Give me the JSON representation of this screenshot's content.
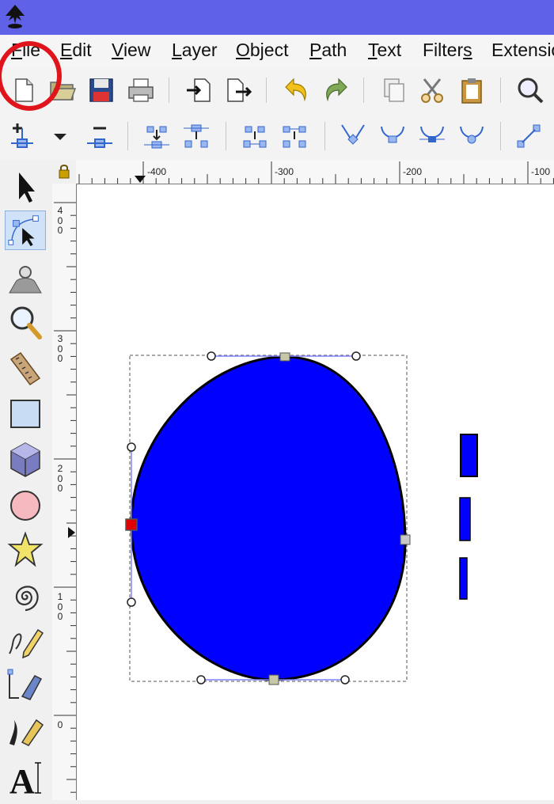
{
  "app": {
    "logo_icon": "inkscape-logo-icon"
  },
  "menu": [
    {
      "id": "file",
      "label": "File",
      "u": "F",
      "rest": "ile"
    },
    {
      "id": "edit",
      "label": "Edit",
      "u": "E",
      "rest": "dit"
    },
    {
      "id": "view",
      "label": "View",
      "u": "V",
      "rest": "iew"
    },
    {
      "id": "layer",
      "label": "Layer",
      "u": "L",
      "rest": "ayer"
    },
    {
      "id": "object",
      "label": "Object",
      "u": "O",
      "rest": "bject"
    },
    {
      "id": "path",
      "label": "Path",
      "u": "P",
      "rest": "ath"
    },
    {
      "id": "text",
      "label": "Text",
      "u": "T",
      "rest": "ext"
    },
    {
      "id": "filters",
      "label": "Filters",
      "pre": "Filter",
      "u": "s",
      "rest": ""
    },
    {
      "id": "extensions",
      "label": "Extensio",
      "pre": "Extensio",
      "u": "",
      "rest": ""
    }
  ],
  "toolbar_icons": [
    "new-document-icon",
    "open-folder-icon",
    "save-icon",
    "print-icon",
    "import-icon",
    "export-icon",
    "undo-icon",
    "redo-icon",
    "duplicate-icon",
    "cut-icon",
    "paste-icon",
    "zoom-icon"
  ],
  "node_toolbar_icons": [
    "insert-node-icon",
    "dropdown-icon",
    "delete-node-icon",
    "join-nodes-icon",
    "break-path-icon",
    "join-segment-icon",
    "delete-segment-icon",
    "cusp-node-icon",
    "smooth-node-icon",
    "symmetric-node-icon",
    "auto-smooth-node-icon",
    "line-segment-icon"
  ],
  "tools": [
    "selector-tool-icon",
    "node-tool-icon",
    "tweak-tool-icon",
    "zoom-tool-icon",
    "measure-tool-icon",
    "rectangle-tool-icon",
    "3d-box-tool-icon",
    "ellipse-tool-icon",
    "star-tool-icon",
    "spiral-tool-icon",
    "pencil-tool-icon",
    "pen-tool-icon",
    "calligraphy-tool-icon",
    "text-tool-icon"
  ],
  "hruler": {
    "labels": [
      "-400",
      "-300",
      "-200",
      "-100"
    ]
  },
  "vruler": {
    "labels": [
      "400",
      "300",
      "200",
      "100",
      "0"
    ]
  },
  "colors": {
    "accent": "#5f62e6",
    "shape_fill": "#0000ff",
    "selected_node": "#e00000",
    "highlight_ring": "#e0151c"
  }
}
